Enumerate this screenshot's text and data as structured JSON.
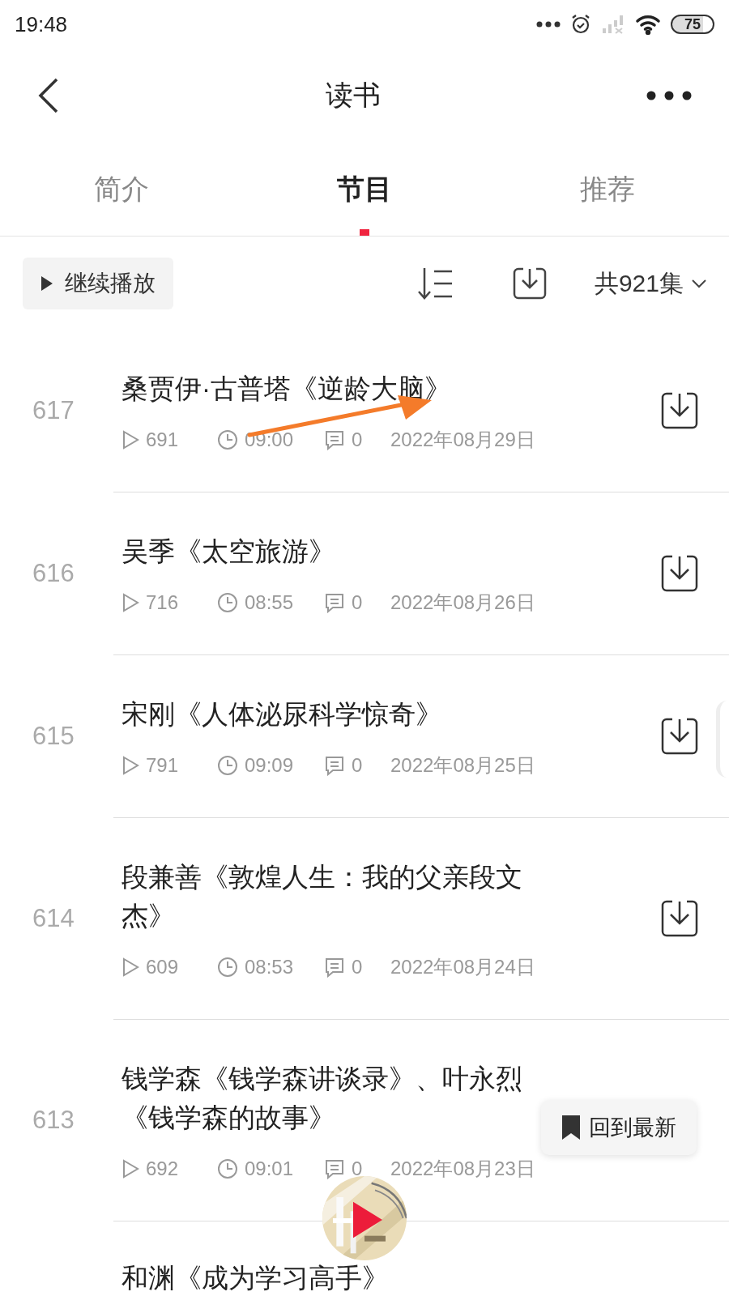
{
  "status_bar": {
    "time": "19:48",
    "battery": "75"
  },
  "header": {
    "title": "读书"
  },
  "tabs": [
    {
      "label": "简介",
      "selected": false
    },
    {
      "label": "节目",
      "selected": true
    },
    {
      "label": "推荐",
      "selected": false
    }
  ],
  "toolbar": {
    "continue_button": "继续播放",
    "episode_count": "共921集"
  },
  "episodes": [
    {
      "number": "617",
      "title": "桑贾伊·古普塔《逆龄大脑》",
      "plays": "691",
      "duration": "09:00",
      "comments": "0",
      "date": "2022年08月29日",
      "download": true
    },
    {
      "number": "616",
      "title": "吴季《太空旅游》",
      "plays": "716",
      "duration": "08:55",
      "comments": "0",
      "date": "2022年08月26日",
      "download": true
    },
    {
      "number": "615",
      "title": "宋刚《人体泌尿科学惊奇》",
      "plays": "791",
      "duration": "09:09",
      "comments": "0",
      "date": "2022年08月25日",
      "download": true
    },
    {
      "number": "614",
      "title": "段兼善《敦煌人生：我的父亲段文杰》",
      "plays": "609",
      "duration": "08:53",
      "comments": "0",
      "date": "2022年08月24日",
      "download": true
    },
    {
      "number": "613",
      "title": "钱学森《钱学森讲谈录》、叶永烈《钱学森的故事》",
      "plays": "692",
      "duration": "09:01",
      "comments": "0",
      "date": "2022年08月23日",
      "download": false
    },
    {
      "title": "和渊《成为学习高手》"
    }
  ],
  "back_to_latest": "回到最新"
}
